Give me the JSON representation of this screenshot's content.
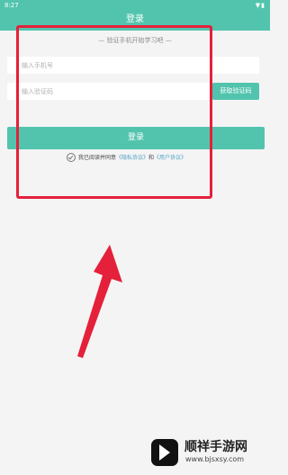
{
  "status_bar": {
    "time": "8:27",
    "icons": "▼▮"
  },
  "header": {
    "title": "登录"
  },
  "login_form": {
    "subtitle": "— 验证手机开始学习吧 —",
    "phone_placeholder": "输入手机号",
    "code_placeholder": "输入验证码",
    "get_code_label": "获取验证码",
    "login_label": "登录",
    "agreement": {
      "prefix": "我已阅读并同意",
      "privacy_link": "《隐私协议》",
      "connector": "和",
      "user_link": "《用户协议》"
    }
  },
  "colors": {
    "accent": "#52c4ad",
    "annotation": "#e5203a",
    "background": "#f4f4f4"
  },
  "watermark": {
    "name": "顺祥手游网",
    "url": "www.bjsxsy.com"
  }
}
